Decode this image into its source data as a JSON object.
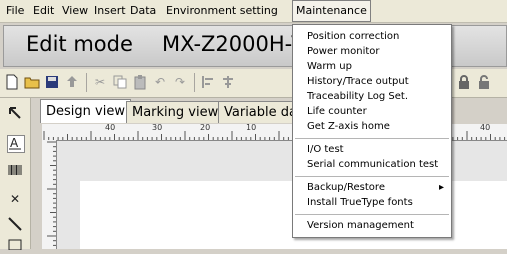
{
  "menubar": {
    "items": [
      "File",
      "Edit",
      "View",
      "Insert",
      "Data",
      "Environment setting",
      "Maintenance"
    ]
  },
  "title": {
    "mode": "Edit mode",
    "model": "MX-Z2000H-V"
  },
  "tabs": [
    "Design view",
    "Marking view",
    "Variable da"
  ],
  "ruler": {
    "labels": [
      "40",
      "30",
      "20",
      "10",
      "40"
    ]
  },
  "maintenance_menu": {
    "group1": [
      "Position correction",
      "Power monitor",
      "Warm up",
      "History/Trace output",
      "Traceability Log Set.",
      "Life counter",
      "Get Z-axis home"
    ],
    "group2": [
      "I/O test",
      "Serial communication test"
    ],
    "group3": [
      "Backup/Restore",
      "Install TrueType fonts"
    ],
    "group4": [
      "Version management"
    ],
    "submenu_arrow": "▸"
  }
}
